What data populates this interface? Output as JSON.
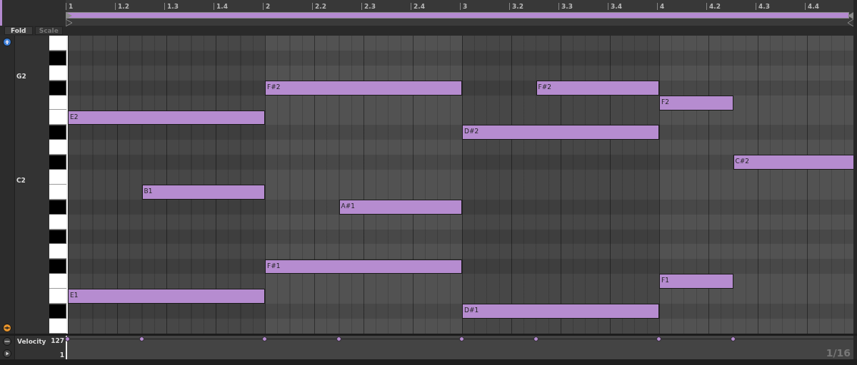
{
  "ruler": {
    "labels": [
      "1",
      "1.2",
      "1.3",
      "1.4",
      "2",
      "2.2",
      "2.3",
      "2.4",
      "3",
      "3.2",
      "3.3",
      "3.4",
      "4",
      "4.2",
      "4.3",
      "4.4"
    ]
  },
  "buttons": [
    {
      "label": "Fold",
      "disabled": false
    },
    {
      "label": "Scale",
      "disabled": true
    }
  ],
  "keys": [
    {
      "kind": "white"
    },
    {
      "kind": "black"
    },
    {
      "kind": "white",
      "label": "G2"
    },
    {
      "kind": "black"
    },
    {
      "kind": "white"
    },
    {
      "kind": "white"
    },
    {
      "kind": "black"
    },
    {
      "kind": "white"
    },
    {
      "kind": "black"
    },
    {
      "kind": "white",
      "label": "C2"
    },
    {
      "kind": "white"
    },
    {
      "kind": "black"
    },
    {
      "kind": "white"
    },
    {
      "kind": "black"
    },
    {
      "kind": "white"
    },
    {
      "kind": "black"
    },
    {
      "kind": "white"
    },
    {
      "kind": "white"
    },
    {
      "kind": "black"
    },
    {
      "kind": "white"
    }
  ],
  "notes": [
    {
      "label": "F#2"
    },
    {
      "label": "F#2"
    },
    {
      "label": "F2"
    },
    {
      "label": "E2"
    },
    {
      "label": "D#2"
    },
    {
      "label": "C#2"
    },
    {
      "label": "B1"
    },
    {
      "label": "A#1"
    },
    {
      "label": "F#1"
    },
    {
      "label": "F1"
    },
    {
      "label": "E1"
    },
    {
      "label": "D#1"
    }
  ],
  "velocity_lane": {
    "title": "Velocity",
    "max": "127",
    "min": "1"
  },
  "grid": "1/16"
}
